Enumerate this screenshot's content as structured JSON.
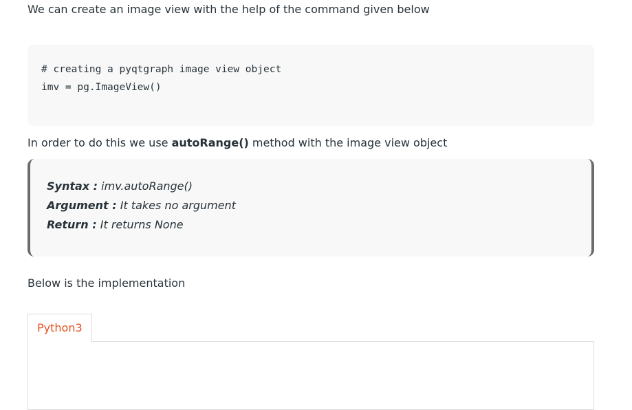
{
  "intro_text": "We can create an image view with the help of the command given below",
  "code": {
    "line1": "# creating a pyqtgraph image view object",
    "line2": "imv = pg.ImageView()"
  },
  "method_text": {
    "before": "In order to do this we use ",
    "method": "autoRange()",
    "after": " method with the image view object"
  },
  "syntax": {
    "syntax_label": "Syntax :",
    "syntax_value": " imv.autoRange()",
    "argument_label": "Argument :",
    "argument_value": " It takes no argument",
    "return_label": "Return :",
    "return_value": " It returns None"
  },
  "implementation_text": "Below is the implementation",
  "tabs": [
    {
      "label": "Python3"
    }
  ],
  "colors": {
    "text": "#273239",
    "tab_accent": "#e2521f",
    "code_bg": "#f8f8f8",
    "blockquote_border": "#6b6b6b"
  }
}
